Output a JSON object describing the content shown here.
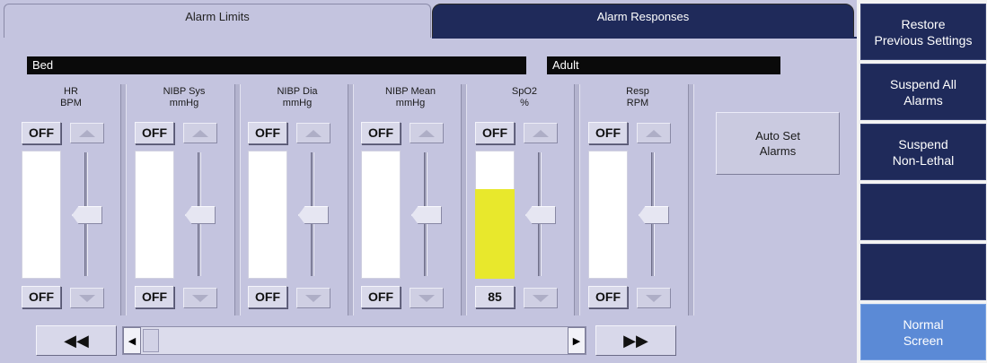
{
  "tabs": {
    "active": "Alarm Limits",
    "other": "Alarm Responses"
  },
  "patient": {
    "bed": "Bed",
    "type": "Adult"
  },
  "columns": [
    {
      "label": "HR\nBPM",
      "high": "OFF",
      "low": "OFF",
      "fill_fraction": 0,
      "fill_color": "#ffffff"
    },
    {
      "label": "NIBP Sys\nmmHg",
      "high": "OFF",
      "low": "OFF",
      "fill_fraction": 0,
      "fill_color": "#ffffff"
    },
    {
      "label": "NIBP Dia\nmmHg",
      "high": "OFF",
      "low": "OFF",
      "fill_fraction": 0,
      "fill_color": "#ffffff"
    },
    {
      "label": "NIBP Mean\nmmHg",
      "high": "OFF",
      "low": "OFF",
      "fill_fraction": 0,
      "fill_color": "#ffffff"
    },
    {
      "label": "SpO2\n%",
      "high": "OFF",
      "low": "85",
      "fill_fraction": 0.7,
      "fill_color": "#e8e82c"
    },
    {
      "label": "Resp\nRPM",
      "high": "OFF",
      "low": "OFF",
      "fill_fraction": 0,
      "fill_color": "#ffffff"
    }
  ],
  "auto_set": "Auto Set\nAlarms",
  "nav": {
    "first": "◀◀",
    "last": "▶▶",
    "left": "◀",
    "right": "▶"
  },
  "side_buttons": [
    {
      "label": "Restore\nPrevious Settings"
    },
    {
      "label": "Suspend All\nAlarms"
    },
    {
      "label": "Suspend\nNon-Lethal"
    },
    {
      "label": ""
    },
    {
      "label": ""
    },
    {
      "label": "Normal\nScreen"
    }
  ],
  "colors": {
    "panel": "#c4c4df",
    "nav_dark": "#1f2a5a",
    "active_blue": "#5b8ad6",
    "spo2_fill": "#e8e82c"
  }
}
